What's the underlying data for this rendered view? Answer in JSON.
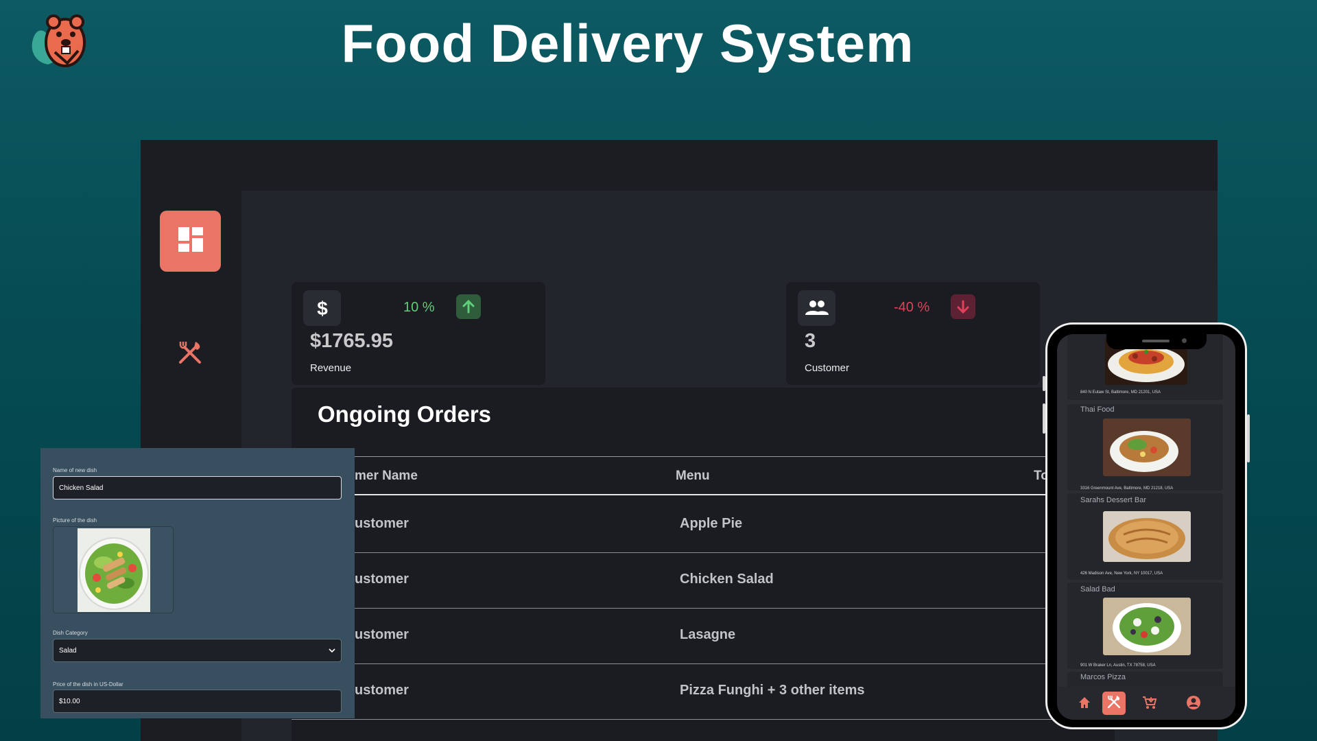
{
  "page": {
    "title": "Food Delivery System",
    "logo_icon": "beaver-logo-icon"
  },
  "colors": {
    "accent": "#ea7466",
    "positive": "#5fcf7a",
    "negative": "#e0405a",
    "panel": "#1b1c21",
    "form_bg": "#374f5f"
  },
  "sidebar": {
    "items": [
      {
        "name": "dashboard",
        "icon": "dashboard-grid-icon",
        "active": true
      },
      {
        "name": "dishes",
        "icon": "fork-knife-icon",
        "active": false
      }
    ]
  },
  "stats": {
    "revenue": {
      "icon": "dollar-icon",
      "percent": "10 %",
      "trend_icon": "arrow-up-icon",
      "value": "$1765.95",
      "label": "Revenue"
    },
    "customers": {
      "icon": "people-icon",
      "percent": "-40 %",
      "trend_icon": "arrow-down-icon",
      "value": "3",
      "label": "Customer"
    }
  },
  "orders": {
    "title": "Ongoing Orders",
    "columns": [
      "mer Name",
      "Menu",
      "To"
    ],
    "rows": [
      {
        "customer": "ustomer",
        "menu": "Apple Pie"
      },
      {
        "customer": "ustomer",
        "menu": "Chicken Salad"
      },
      {
        "customer": "ustomer",
        "menu": "Lasagne"
      },
      {
        "customer": "ustomer",
        "menu": "Pizza Funghi + 3 other items"
      }
    ]
  },
  "add_dish_form": {
    "name_label": "Name of new dish",
    "name_value": "Chicken Salad",
    "picture_label": "Picture of the dish",
    "picture_icon": "chicken-salad-photo",
    "category_label": "Dish Category",
    "category_value": "Salad",
    "price_label": "Price of the dish in US-Dollar",
    "price_value": "$10.00"
  },
  "phone": {
    "restaurants": [
      {
        "name": "",
        "address": "840 N Eutaw St, Baltimore, MD 21201, USA",
        "image": "spaghetti-photo"
      },
      {
        "name": "Thai Food",
        "address": "3316 Greenmount Ave, Baltimore, MD 21218, USA",
        "image": "thai-noodles-photo"
      },
      {
        "name": "Sarahs Dessert Bar",
        "address": "426 Madison Ave, New York, NY 10017, USA",
        "image": "pie-photo"
      },
      {
        "name": "Salad Bad",
        "address": "901 W Braker Ln, Austin, TX 78758, USA",
        "image": "salad-bowl-photo"
      },
      {
        "name": "Marcos Pizza",
        "address": "",
        "image": ""
      }
    ],
    "tabs": [
      {
        "name": "home",
        "icon": "home-icon",
        "active": false
      },
      {
        "name": "restaurants",
        "icon": "fork-knife-icon",
        "active": true
      },
      {
        "name": "cart",
        "icon": "cart-icon",
        "active": false
      },
      {
        "name": "profile",
        "icon": "account-circle-icon",
        "active": false
      }
    ]
  }
}
